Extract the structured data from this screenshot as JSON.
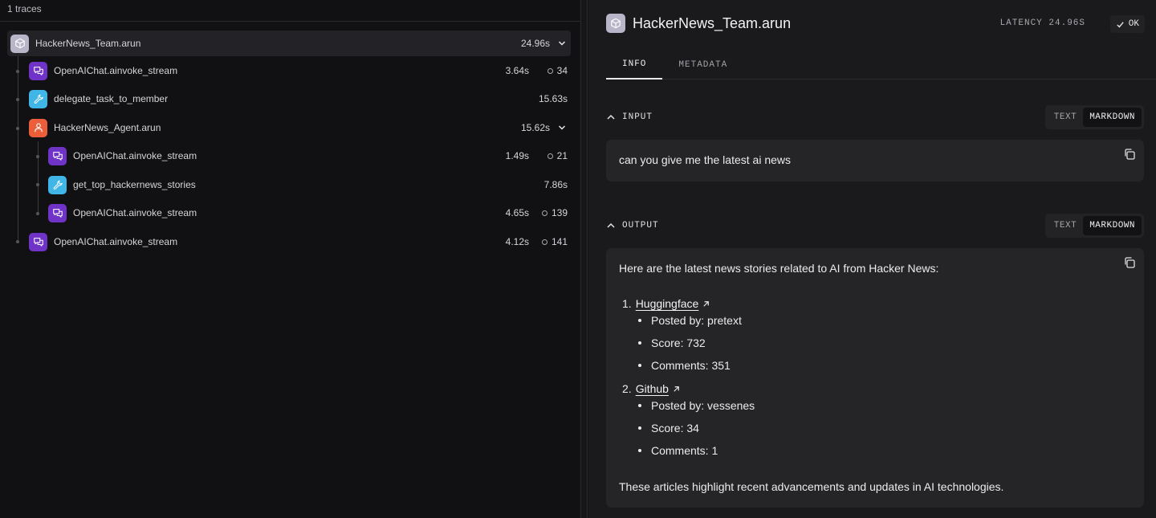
{
  "left": {
    "header": "1 traces",
    "rows": [
      {
        "name": "HackerNews_Team.arun",
        "duration": "24.96s",
        "tokens": "",
        "type": "team"
      },
      {
        "name": "OpenAIChat.ainvoke_stream",
        "duration": "3.64s",
        "tokens": "34",
        "type": "chat"
      },
      {
        "name": "delegate_task_to_member",
        "duration": "15.63s",
        "tokens": "",
        "type": "tool"
      },
      {
        "name": "HackerNews_Agent.arun",
        "duration": "15.62s",
        "tokens": "",
        "type": "agent"
      },
      {
        "name": "OpenAIChat.ainvoke_stream",
        "duration": "1.49s",
        "tokens": "21",
        "type": "chat"
      },
      {
        "name": "get_top_hackernews_stories",
        "duration": "7.86s",
        "tokens": "",
        "type": "tool"
      },
      {
        "name": "OpenAIChat.ainvoke_stream",
        "duration": "4.65s",
        "tokens": "139",
        "type": "chat"
      },
      {
        "name": "OpenAIChat.ainvoke_stream",
        "duration": "4.12s",
        "tokens": "141",
        "type": "chat"
      }
    ]
  },
  "right": {
    "title": "HackerNews_Team.arun",
    "latency": "LATENCY 24.96S",
    "status": "OK",
    "tabs": [
      "INFO",
      "METADATA"
    ],
    "input": {
      "label": "INPUT",
      "toggle": [
        "TEXT",
        "MARKDOWN"
      ],
      "text": "can you give me the latest ai news"
    },
    "output": {
      "label": "OUTPUT",
      "toggle": [
        "TEXT",
        "MARKDOWN"
      ],
      "intro": "Here are the latest news stories related to AI from Hacker News:",
      "items": [
        {
          "num": "1.",
          "title": "Huggingface",
          "posted": "Posted by: pretext",
          "score": "Score: 732",
          "comments": "Comments: 351"
        },
        {
          "num": "2.",
          "title": "Github",
          "posted": "Posted by: vessenes",
          "score": "Score: 34",
          "comments": "Comments: 1"
        }
      ],
      "outro": "These articles highlight recent advancements and updates in AI technologies."
    }
  },
  "colors": {
    "team": "#b7b5c7",
    "chat": "#6f34c7",
    "tool": "#3fb5e8",
    "agent": "#ec5e3a"
  },
  "icons": {
    "team": "cube-icon",
    "chat": "chat-bubbles-icon",
    "tool": "wrench-icon",
    "agent": "person-icon"
  }
}
